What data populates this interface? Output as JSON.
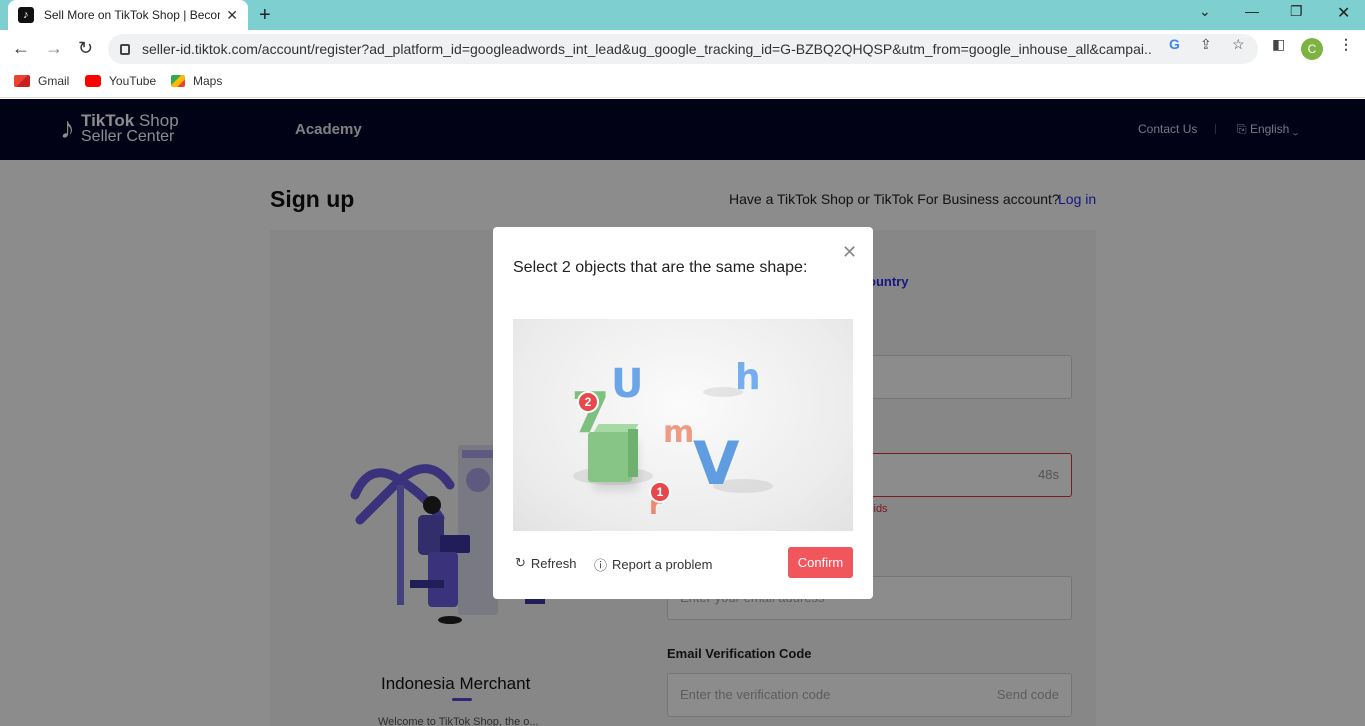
{
  "browser": {
    "tab_title": "Sell More on TikTok Shop | Becom",
    "url": "seller-id.tiktok.com/account/register?ad_platform_id=googleadwords_int_lead&ug_google_tracking_id=G-BZBQ2QHQSP&utm_from=google_inhouse_all&campai...",
    "profile_initial": "C",
    "bookmarks": [
      "Gmail",
      "YouTube",
      "Maps"
    ]
  },
  "header": {
    "logo_line1_bold": "TikTok",
    "logo_line1_rest": " Shop",
    "logo_line2": "Seller Center",
    "nav_academy": "Academy",
    "contact": "Contact Us",
    "language": "English"
  },
  "page": {
    "title": "Sign up",
    "have_account": "Have a TikTok Shop or TikTok For Business account?",
    "login": "Log in",
    "country_link": "ountry",
    "timer": "48s",
    "error_fragment": "cids",
    "email_placeholder": "Enter your email address",
    "email_verification_label": "Email Verification Code",
    "verification_placeholder": "Enter the verification code",
    "send_code": "Send code",
    "merchant_title": "Indonesia Merchant",
    "welcome_text": "Welcome to TikTok Shop, the o..."
  },
  "captcha": {
    "prompt": "Select 2 objects that are the same shape:",
    "glyphs": {
      "u": "U",
      "h": "h",
      "m": "m",
      "v": "V",
      "seven": "7",
      "small": "r"
    },
    "marker_1": "1",
    "marker_2": "2",
    "refresh": "Refresh",
    "report": "Report a problem",
    "confirm": "Confirm"
  },
  "colors": {
    "accent": "#f0565b",
    "header_bg": "#05052a",
    "link": "#2a2af0",
    "tabbar": "#7ecfcf"
  }
}
